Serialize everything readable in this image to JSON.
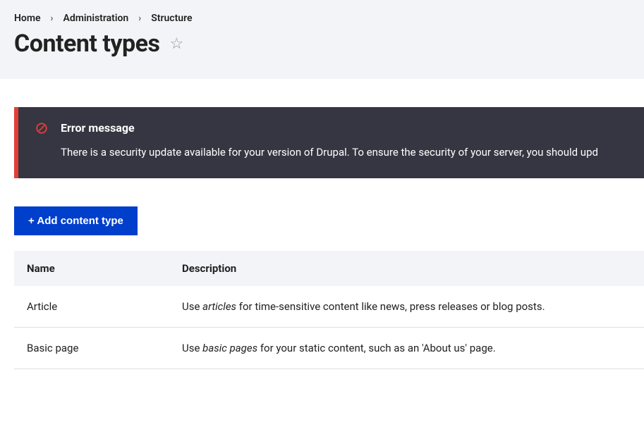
{
  "breadcrumb": {
    "items": [
      "Home",
      "Administration",
      "Structure"
    ]
  },
  "page": {
    "title": "Content types"
  },
  "error": {
    "title": "Error message",
    "body": "There is a security update available for your version of Drupal. To ensure the security of your server, you should upd"
  },
  "actions": {
    "add_label": "+ Add content type"
  },
  "table": {
    "headers": {
      "name": "Name",
      "description": "Description"
    },
    "rows": [
      {
        "name": "Article",
        "desc_prefix": "Use ",
        "desc_em": "articles",
        "desc_suffix": " for time-sensitive content like news, press releases or blog posts."
      },
      {
        "name": "Basic page",
        "desc_prefix": "Use ",
        "desc_em": "basic pages",
        "desc_suffix": " for your static content, such as an 'About us' page."
      }
    ]
  }
}
